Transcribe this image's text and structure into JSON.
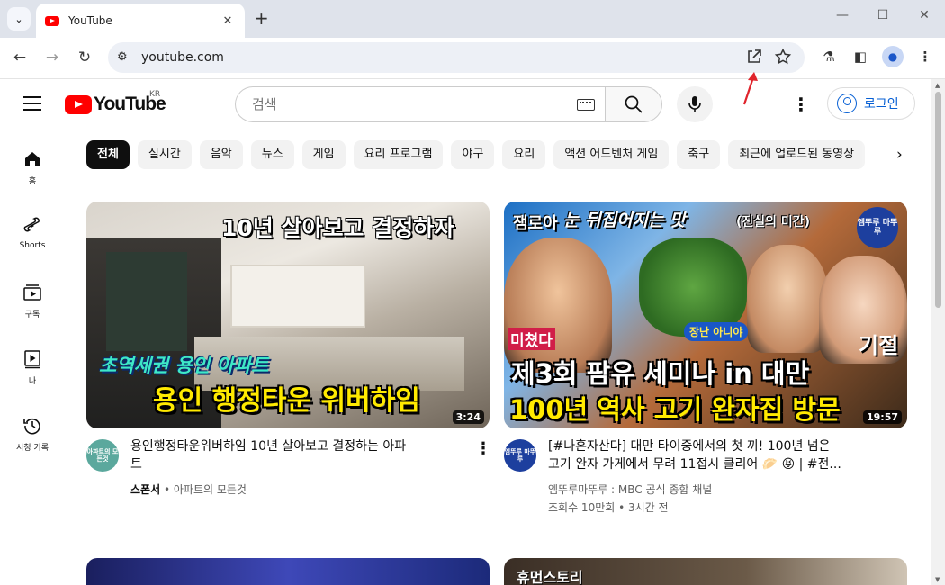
{
  "browser": {
    "tab_title": "YouTube",
    "tab_close": "✕",
    "new_tab": "+",
    "url": "youtube.com",
    "window": {
      "minimize": "—",
      "maximize": "☐",
      "close": "✕"
    }
  },
  "masthead": {
    "logo_text": "YouTube",
    "region": "KR",
    "search_placeholder": "검색",
    "signin_label": "로그인"
  },
  "guide": [
    {
      "label": "홈",
      "icon": "home-icon"
    },
    {
      "label": "Shorts",
      "icon": "shorts-icon"
    },
    {
      "label": "구독",
      "icon": "subscriptions-icon"
    },
    {
      "label": "나",
      "icon": "you-icon"
    },
    {
      "label": "시청 기록",
      "icon": "history-icon"
    }
  ],
  "chips": [
    "전체",
    "실시간",
    "음악",
    "뉴스",
    "게임",
    "요리 프로그램",
    "야구",
    "요리",
    "액션 어드벤처 게임",
    "축구",
    "최근에 업로드된 동영상"
  ],
  "videos": [
    {
      "thumb_headline": "10년 살아보고 결정하자",
      "thumb_tag": "초역세권 용인 아파트",
      "thumb_main": "용인 행정타운 위버하임",
      "duration": "3:24",
      "avatar_text": "아파트의 모든것",
      "title_line1": "용인행정타운위버하임 10년 살아보고 결정하는 아파",
      "title_line2": "트",
      "sponsor": "스폰서",
      "channel": "아파트의 모든것"
    },
    {
      "thumb_top": "잼로아",
      "thumb_top2": "눈 뒤집어지는 맛",
      "thumb_top3": "(진실의 미간)",
      "thumb_badge": "엠뚜루 마뚜루",
      "thumb_crazy": "미쳤다",
      "thumb_joke": "장난 아니야",
      "thumb_faint": "기절",
      "thumb_main1": "제3회 팜유 세미나 in 대만",
      "thumb_main2": "100년 역사 고기 완자집 방문",
      "duration": "19:57",
      "avatar_text": "엠뚜루 마뚜루",
      "title_line1": "[#나혼자산다] 대만 타이중에서의 첫 끼! 100년 넘은",
      "title_line2": "고기 완자 가게에서 무려 11접시 클리어 🥟 😝 | #전...",
      "channel": "엠뚜루마뚜루 : MBC 공식 종합 채널",
      "stats": "조회수 10만회 • 3시간 전"
    },
    {
      "thumb_text": "휴먼스토리"
    }
  ],
  "colors": {
    "brand_red": "#ff0000",
    "link_blue": "#065fd4",
    "annotation_red": "#e0232b"
  }
}
